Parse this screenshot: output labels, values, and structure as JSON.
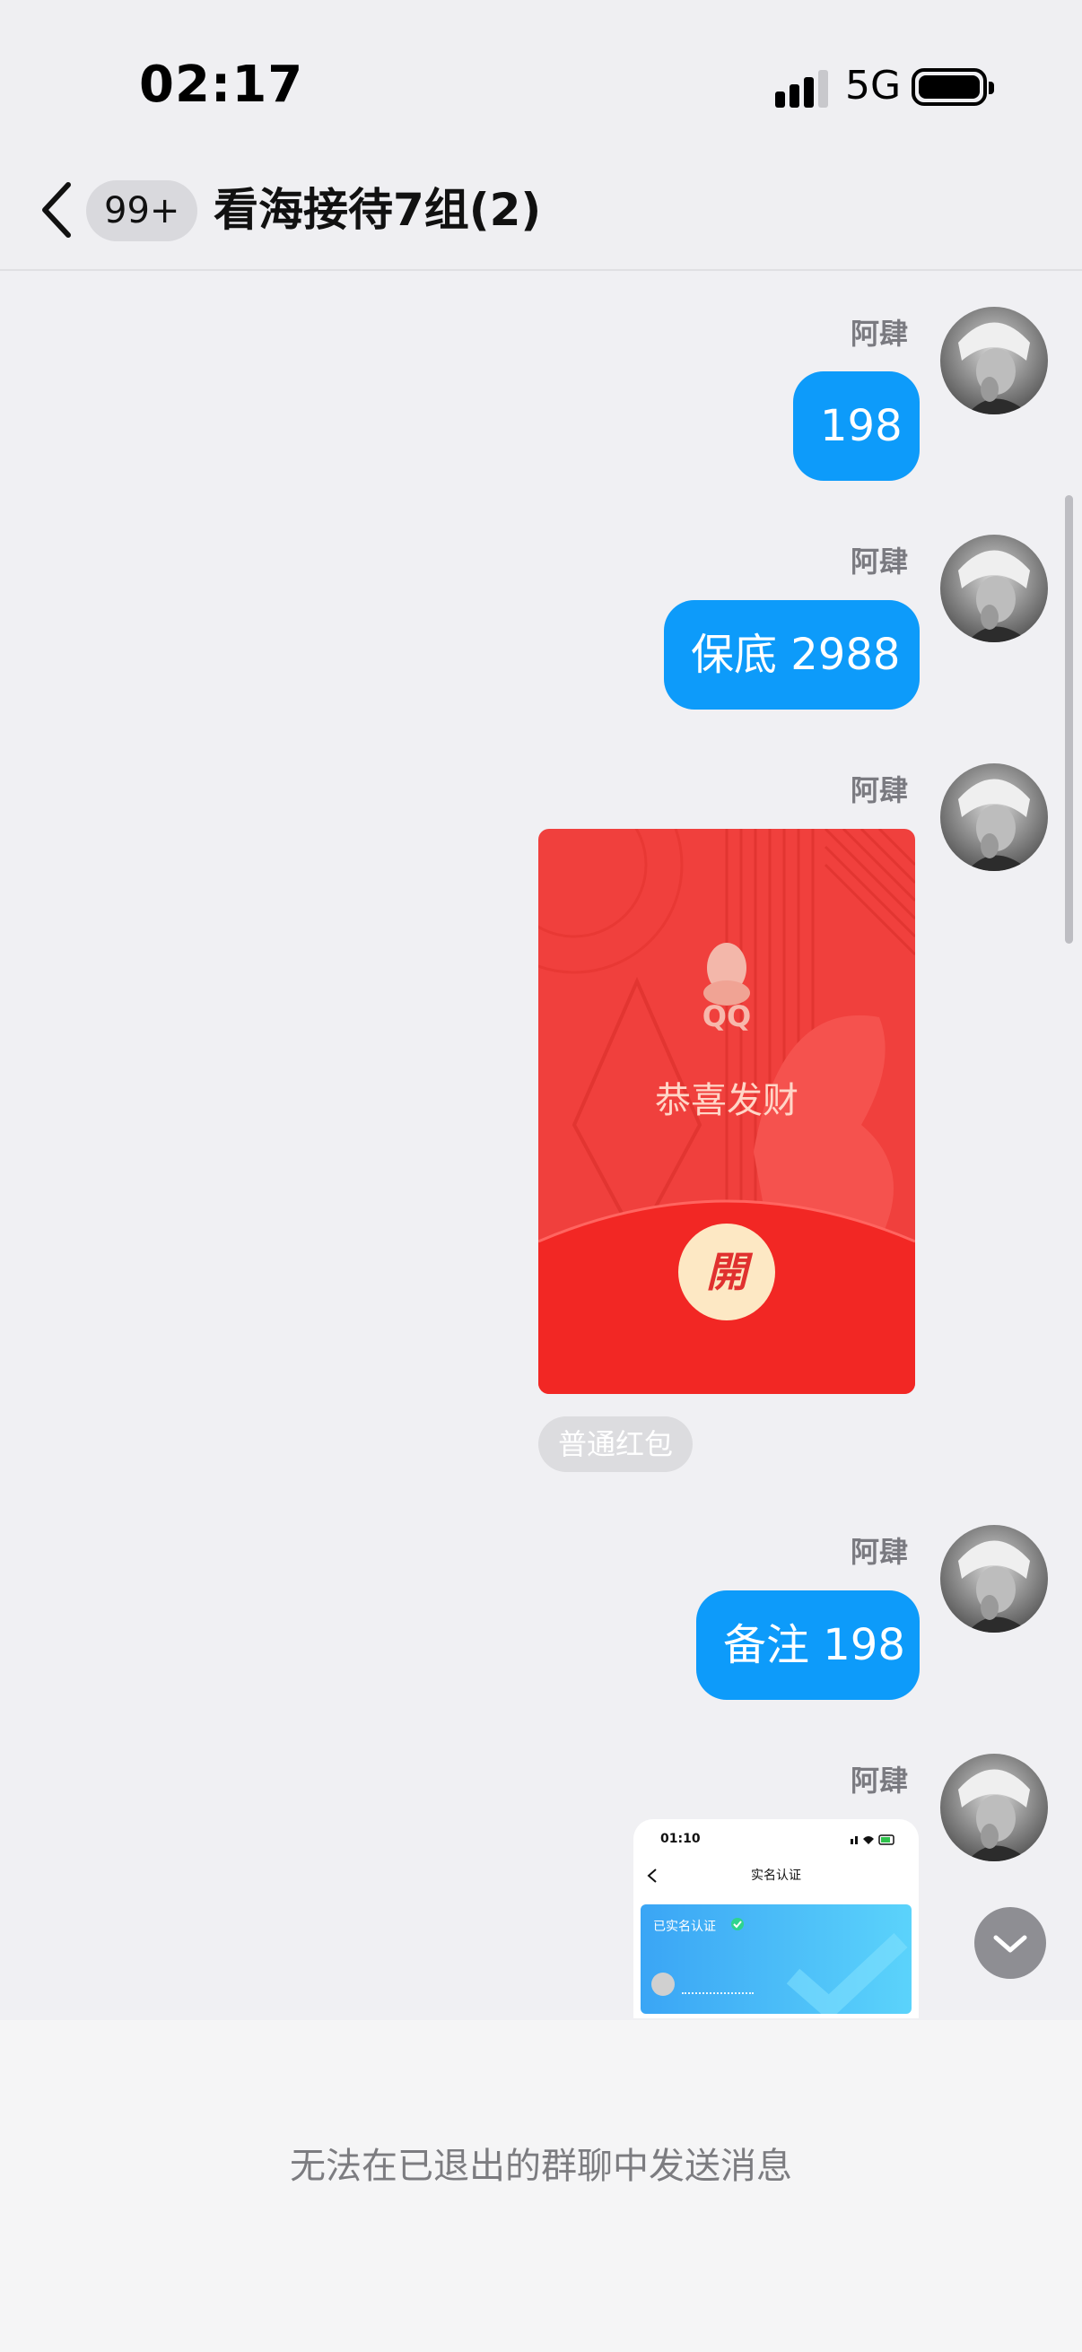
{
  "status_bar": {
    "time": "02:17",
    "network": "5G"
  },
  "header": {
    "unread_badge": "99+",
    "title": "看海接待7组(2)"
  },
  "messages": [
    {
      "sender": "阿肆",
      "type": "text",
      "text": "198"
    },
    {
      "sender": "阿肆",
      "type": "text",
      "text": "保底 2988"
    },
    {
      "sender": "阿肆",
      "type": "red_envelope",
      "logo_text": "QQ",
      "greeting": "恭喜发财",
      "open_label": "開",
      "label": "普通红包"
    },
    {
      "sender": "阿肆",
      "type": "text",
      "text": "备注 198"
    },
    {
      "sender": "阿肆",
      "type": "image",
      "preview": {
        "time": "01:10",
        "title": "实名认证",
        "card_label": "已实名认证"
      }
    }
  ],
  "footer": {
    "notice": "无法在已退出的群聊中发送消息"
  },
  "colors": {
    "bubble": "#0d9bfa",
    "envelope_red": "#f03a3a",
    "background": "#f0f0f3"
  }
}
